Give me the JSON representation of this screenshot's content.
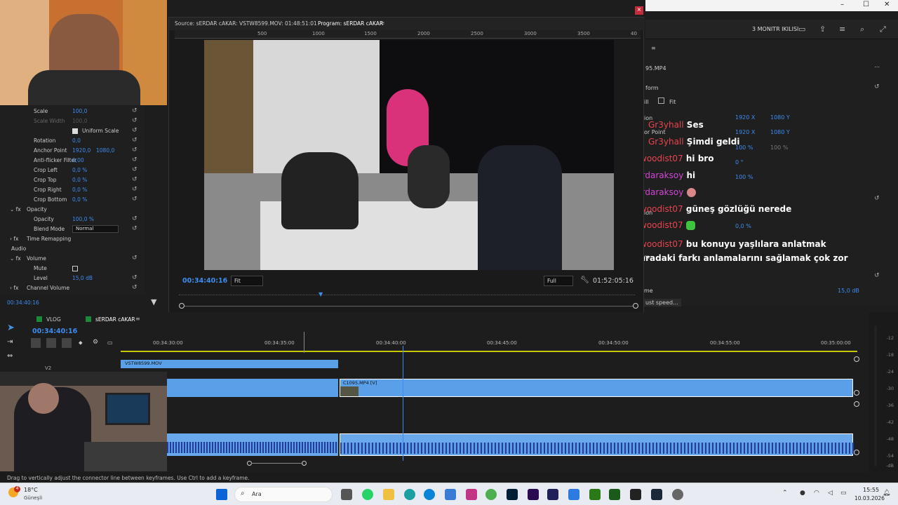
{
  "window": {
    "minimize": "–",
    "maximize": "☐",
    "close": "✕"
  },
  "header": {
    "workspace": "3 MONITR IKILISI"
  },
  "effect_controls": {
    "rows": [
      {
        "label": "Scale",
        "value": "100,0"
      },
      {
        "label": "Scale Width",
        "value": "100,0"
      },
      {
        "label": "Uniform Scale",
        "value": ""
      },
      {
        "label": "Rotation",
        "value": "0,0"
      },
      {
        "label": "Anchor Point",
        "value": "1920,0",
        "value2": "1080,0"
      },
      {
        "label": "Anti-flicker Filter",
        "value": "0,00"
      },
      {
        "label": "Crop Left",
        "value": "0,0 %"
      },
      {
        "label": "Crop Top",
        "value": "0,0 %"
      },
      {
        "label": "Crop Right",
        "value": "0,0 %"
      },
      {
        "label": "Crop Bottom",
        "value": "0,0 %"
      },
      {
        "label": "Opacity",
        "value": ""
      },
      {
        "label": "Opacity",
        "value": "100,0 %"
      },
      {
        "label": "Blend Mode",
        "value": "Normal"
      },
      {
        "label": "Time Remapping",
        "value": ""
      },
      {
        "label": "Audio",
        "value": ""
      },
      {
        "label": "Volume",
        "value": ""
      },
      {
        "label": "Mute",
        "value": ""
      },
      {
        "label": "Level",
        "value": "15,0 dB"
      },
      {
        "label": "Channel Volume",
        "value": ""
      }
    ],
    "timecode": "00:34:40:16"
  },
  "monitor": {
    "source_label": "Source: sERDAR cAKAR: VSTW8599.MOV: 01:48:51:01",
    "program_label": "Program: sERDAR cAKAR",
    "ruler": [
      "500",
      "1000",
      "1500",
      "2000",
      "2500",
      "3000",
      "3500",
      "40"
    ],
    "timecode": "00:34:40:16",
    "fit": "Fit",
    "quality": "Full",
    "duration": "01:52:05:16"
  },
  "right_panel": {
    "clip": "95.MP4",
    "section": "form",
    "fit_label": "Fit",
    "values": {
      "pos_x": "1920 X",
      "pos_y": "1080 Y",
      "ap_x": "1920 X",
      "ap_y": "1080 Y",
      "scale": "100 %",
      "scale2": "100 %",
      "rot": "0 °",
      "op": "100 %",
      "flicker": "0,0 %",
      "level": "15,0 dB"
    },
    "labels": {
      "l1": "ion",
      "l2": "or Point",
      "l3": "ill",
      "l4": "m",
      "l5": "me"
    },
    "tooltip": "ust speed..."
  },
  "chat": [
    {
      "user": "Gr3yhall",
      "msg": "Ses",
      "color": "red"
    },
    {
      "user": "Gr3yhall",
      "msg": "Şimdi geldi",
      "color": "red"
    },
    {
      "user": "woodist07",
      "msg": "hi bro",
      "color": "red"
    },
    {
      "user": "s3rdaraksoy",
      "msg": "hi",
      "color": "magenta"
    },
    {
      "user": "s3rdaraksoy",
      "msg": "",
      "color": "magenta"
    },
    {
      "user": "woodist07",
      "msg": "güneş gözlüğü nerede",
      "color": "red"
    },
    {
      "user": "woodist07",
      "msg": "",
      "color": "red"
    },
    {
      "user": "woodist07",
      "msg": "bu konuyu yaşlılara anlatmak aradaki farkı anlamalarını sağlamak çok zor",
      "color": "red"
    }
  ],
  "timeline": {
    "tabs": [
      "VLOG",
      "sERDAR cAKAR"
    ],
    "timecode": "00:34:40:16",
    "ruler": [
      "00:34:30:00",
      "00:34:35:00",
      "00:34:40:00",
      "00:34:45:00",
      "00:34:50:00",
      "00:34:55:00",
      "00:35:00:00"
    ],
    "clip1": "VSTW8599.MOV",
    "clip2": "C1095.MP4 [V]",
    "track_label": "V2",
    "playhead_pct": 0.42
  },
  "meter_ticks": [
    "-12",
    "-18",
    "-24",
    "-30",
    "-36",
    "-42",
    "-48",
    "-54",
    "-dB"
  ],
  "status": "Drag to vertically adjust the connector line between keyframes. Use Ctrl to add a keyframe.",
  "taskbar": {
    "weather_temp": "18°C",
    "weather_loc": "Güneşli",
    "search": "Ara",
    "time": "15:55",
    "date": "10.03.2026",
    "badge": "4"
  },
  "colors": {
    "accent": "#3d8cf0",
    "clip": "#5aa0e8",
    "chat_red": "#e8434f",
    "chat_magenta": "#d146d6"
  }
}
